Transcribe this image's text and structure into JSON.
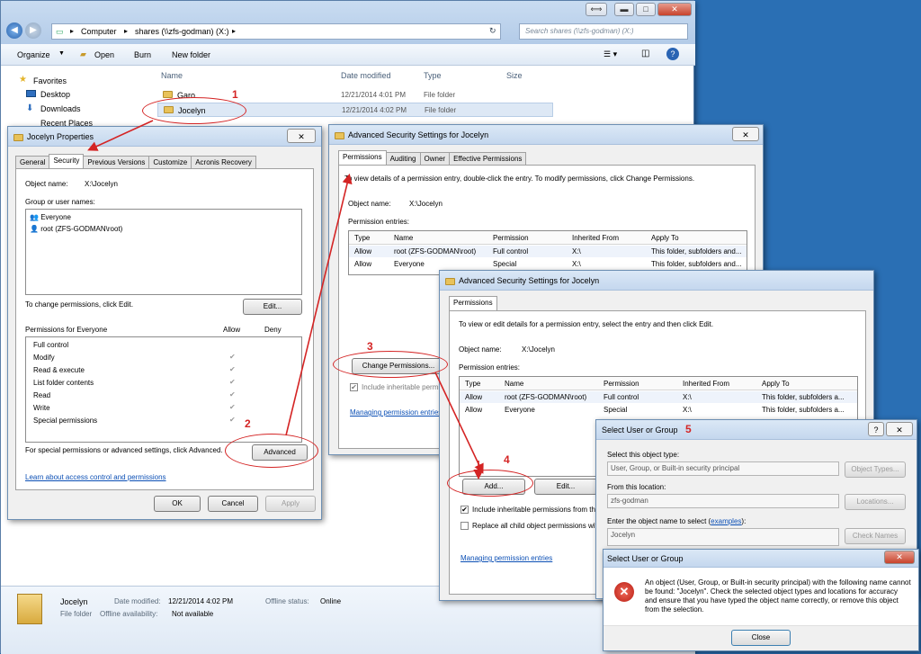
{
  "explorer": {
    "breadcrumb": [
      "Computer",
      "shares (\\\\zfs-godman) (X:)"
    ],
    "search_placeholder": "Search shares (\\\\zfs-godman) (X:)",
    "toolbar": {
      "organize": "Organize",
      "open": "Open",
      "burn": "Burn",
      "new_folder": "New folder"
    },
    "nav": {
      "favorites": "Favorites",
      "desktop": "Desktop",
      "downloads": "Downloads",
      "recent": "Recent Places"
    },
    "columns": {
      "name": "Name",
      "date": "Date modified",
      "type": "Type",
      "size": "Size"
    },
    "files": [
      {
        "name": "Garo",
        "date": "12/21/2014 4:01 PM",
        "type": "File folder"
      },
      {
        "name": "Jocelyn",
        "date": "12/21/2014 4:02 PM",
        "type": "File folder"
      }
    ],
    "details": {
      "name": "Jocelyn",
      "type": "File folder",
      "modified_label": "Date modified:",
      "modified": "12/21/2014 4:02 PM",
      "avail_label": "Offline availability:",
      "avail": "Not available",
      "status_label": "Offline status:",
      "status": "Online"
    }
  },
  "props": {
    "title": "Jocelyn Properties",
    "tabs": [
      "General",
      "Security",
      "Previous Versions",
      "Customize",
      "Acronis Recovery"
    ],
    "object_label": "Object name:",
    "object_value": "X:\\Jocelyn",
    "group_label": "Group or user names:",
    "users": [
      "Everyone",
      "root (ZFS-GODMAN\\root)"
    ],
    "change_text": "To change permissions, click Edit.",
    "edit": "Edit...",
    "perm_for": "Permissions for Everyone",
    "allow": "Allow",
    "deny": "Deny",
    "perms": [
      "Full control",
      "Modify",
      "Read & execute",
      "List folder contents",
      "Read",
      "Write",
      "Special permissions"
    ],
    "special_text": "For special permissions or advanced settings, click Advanced.",
    "advanced": "Advanced",
    "learn": "Learn about access control and permissions",
    "ok": "OK",
    "cancel": "Cancel",
    "apply": "Apply"
  },
  "adv1": {
    "title": "Advanced Security Settings for Jocelyn",
    "tabs": [
      "Permissions",
      "Auditing",
      "Owner",
      "Effective Permissions"
    ],
    "info": "To view details of a permission entry, double-click the entry. To modify permissions, click Change Permissions.",
    "object_label": "Object name:",
    "object_value": "X:\\Jocelyn",
    "entries_label": "Permission entries:",
    "cols": [
      "Type",
      "Name",
      "Permission",
      "Inherited From",
      "Apply To"
    ],
    "rows": [
      [
        "Allow",
        "root (ZFS-GODMAN\\root)",
        "Full control",
        "X:\\",
        "This folder, subfolders and..."
      ],
      [
        "Allow",
        "Everyone",
        "Special",
        "X:\\",
        "This folder, subfolders and..."
      ]
    ],
    "change_btn": "Change Permissions...",
    "include": "Include inheritable permis",
    "manage": "Managing permission entries"
  },
  "adv2": {
    "title": "Advanced Security Settings for Jocelyn",
    "tab": "Permissions",
    "info": "To view or edit details for a permission entry, select the entry and then click Edit.",
    "object_label": "Object name:",
    "object_value": "X:\\Jocelyn",
    "entries_label": "Permission entries:",
    "cols": [
      "Type",
      "Name",
      "Permission",
      "Inherited From",
      "Apply To"
    ],
    "rows": [
      [
        "Allow",
        "root (ZFS-GODMAN\\root)",
        "Full control",
        "X:\\",
        "This folder, subfolders a..."
      ],
      [
        "Allow",
        "Everyone",
        "Special",
        "X:\\",
        "This folder, subfolders a..."
      ]
    ],
    "add": "Add...",
    "edit": "Edit...",
    "include": "Include inheritable permissions from th",
    "replace": "Replace all child object permissions wit",
    "manage": "Managing permission entries"
  },
  "sel": {
    "title": "Select User or Group",
    "type_label": "Select this object type:",
    "type_value": "User, Group, or Built-in security principal",
    "types_btn": "Object Types...",
    "loc_label": "From this location:",
    "loc_value": "zfs-godman",
    "loc_btn": "Locations...",
    "enter_label": "Enter the object name to select (",
    "examples": "examples",
    "enter_close": "):",
    "enter_value": "Jocelyn",
    "check_btn": "Check Names"
  },
  "err": {
    "title": "Select User or Group",
    "message": "An object (User, Group, or Built-in security principal) with the following name cannot be found: \"Jocelyn\". Check the selected object types and locations for accuracy and ensure that you have typed the object name correctly, or remove this object from the selection.",
    "close": "Close"
  },
  "steps": [
    "1",
    "2",
    "3",
    "4",
    "5"
  ]
}
